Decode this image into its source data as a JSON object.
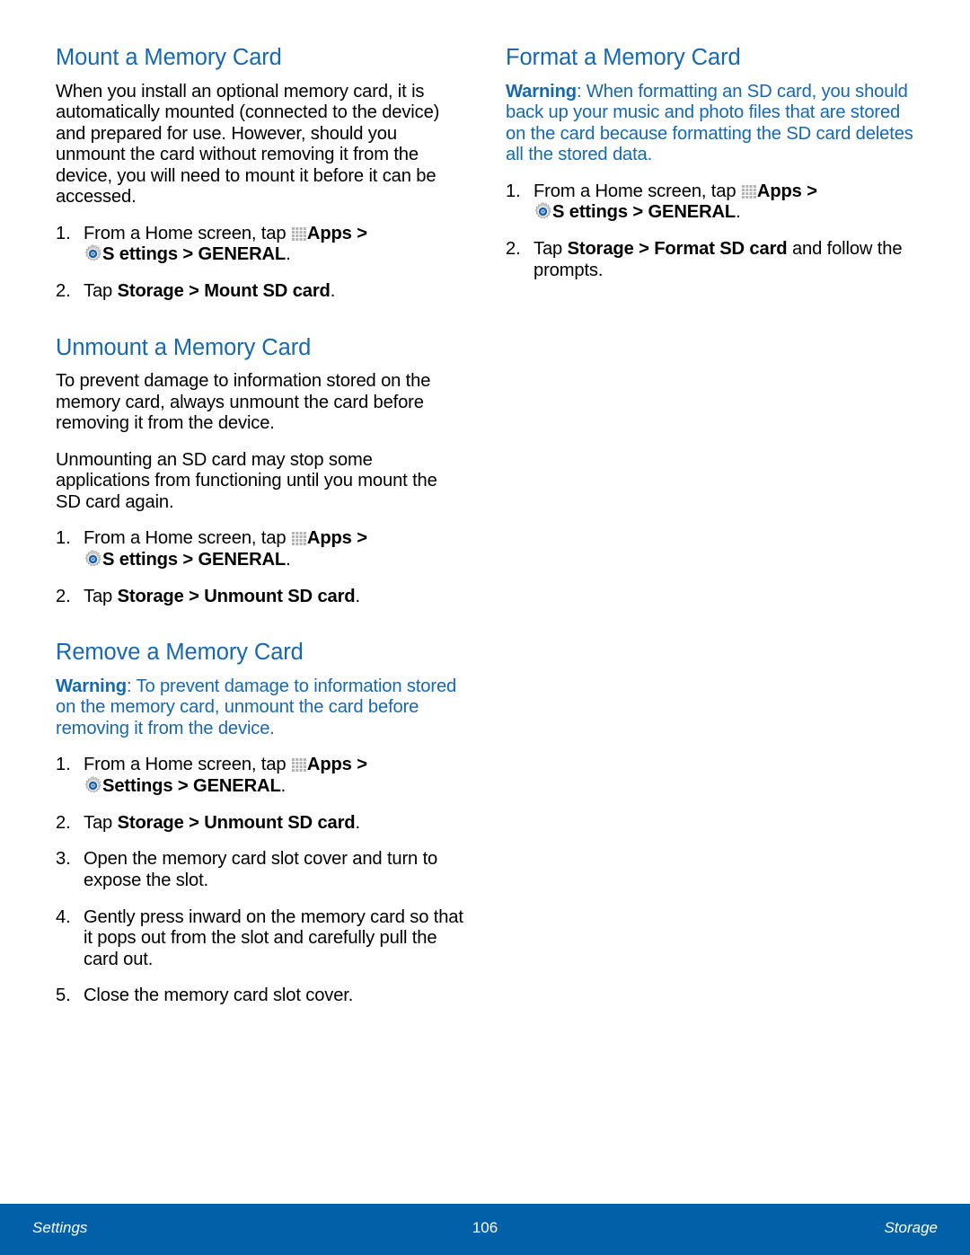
{
  "document": {
    "page_number": "106",
    "footer_left": "Settings",
    "footer_right": "Storage",
    "accent_color": "#1668b0",
    "footer_bar_color": "#0260a8",
    "body_text_color": "#000000"
  },
  "icons": {
    "apps": "apps-grid-icon",
    "settings": "gear-icon"
  },
  "left_column": {
    "section1": {
      "heading": "Mount a Memory Card",
      "paragraph": "When you install an optional memory card, it is automatically mounted (connected to the device) and prepared for use. However, should you unmount the card without removing it from the device, you will need to mount it before it can be accessed.",
      "steps": [
        {
          "number": "1.",
          "pre_apps": "From a Home screen, tap ",
          "apps_label": "Apps",
          "after_apps": " > ",
          "settings_label": "S ettings",
          "after_settings": " > ",
          "general_label": "GENERAL",
          "period": "."
        },
        {
          "number": "2.",
          "plain_prefix": "Tap ",
          "bold_a": "Storage",
          "mid": " > ",
          "bold_b": "Mount SD card",
          "period": "."
        }
      ]
    },
    "section2": {
      "heading": "Unmount a Memory Card",
      "paragraph1": "To prevent damage to information stored on the memory card, always unmount the card before removing it from the device.",
      "paragraph2": "Unmounting an SD card may stop some applications from functioning until you mount the SD card again.",
      "steps": [
        {
          "number": "1.",
          "pre_apps": "From a Home screen, tap ",
          "apps_label": "Apps",
          "after_apps": " > ",
          "settings_label": "S ettings",
          "after_settings": " > ",
          "general_label": "GENERAL",
          "period": "."
        },
        {
          "number": "2.",
          "plain_prefix": "Tap ",
          "bold_a": "Storage",
          "mid": " > ",
          "bold_b": "Unmount SD card",
          "period": "."
        }
      ]
    },
    "section3": {
      "heading": "Remove a Memory Card",
      "warning_label": "Warning",
      "warning_text": ": To prevent damage to information stored on the memory card, unmount the card before removing it from the device.",
      "steps": [
        {
          "number": "1.",
          "pre_apps": "From a Home screen, tap ",
          "apps_label": "Apps",
          "after_apps": " > ",
          "settings_label": "Settings ",
          "after_settings": " > ",
          "general_label": "GENERAL",
          "period": "."
        },
        {
          "number": "2.",
          "plain_prefix": "Tap ",
          "bold_a": "Storage",
          "mid": " > ",
          "bold_b": "Unmount SD card",
          "period": "."
        },
        {
          "number": "3.",
          "text": "Open the memory card slot cover and turn to expose the slot."
        },
        {
          "number": "4.",
          "text": "Gently press inward on the memory card so that it pops out from the slot and carefully pull the card out."
        },
        {
          "number": "5.",
          "text": "Close the memory card slot cover."
        }
      ]
    }
  },
  "right_column": {
    "section1": {
      "heading": "Format a Memory Card",
      "warning_label": "Warning",
      "warning_text": ": When formatting an SD card, you should back up your music and photo files that are stored on the card because formatting the SD card deletes all the stored data.",
      "steps": [
        {
          "number": "1.",
          "pre_apps": "From a Home screen, tap ",
          "apps_label": "Apps",
          "after_apps": " > ",
          "settings_label": "S ettings",
          "after_settings": " > ",
          "general_label": "GENERAL",
          "period": "."
        },
        {
          "number": "2.",
          "plain_prefix": "Tap ",
          "bold_a": "Storage",
          "mid": " > ",
          "bold_b": "Format SD card",
          "suffix": " and follow the prompts."
        }
      ]
    }
  }
}
